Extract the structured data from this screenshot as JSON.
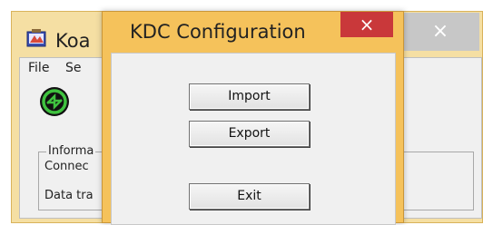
{
  "main_window": {
    "title": "Koa",
    "close_glyph": "×",
    "menu": [
      "File",
      "Se"
    ],
    "status_icon": "sync-status-icon",
    "group": {
      "legend": "Informa",
      "rows": [
        "Connec",
        "Data tra"
      ]
    }
  },
  "dialog": {
    "title": "KDC Configuration",
    "close_glyph": "×",
    "buttons": {
      "import": "Import",
      "export": "Export",
      "exit": "Exit"
    }
  },
  "colors": {
    "frame": "#f5c25b",
    "close_active": "#c9383a",
    "client_bg": "#f0f0f0"
  }
}
